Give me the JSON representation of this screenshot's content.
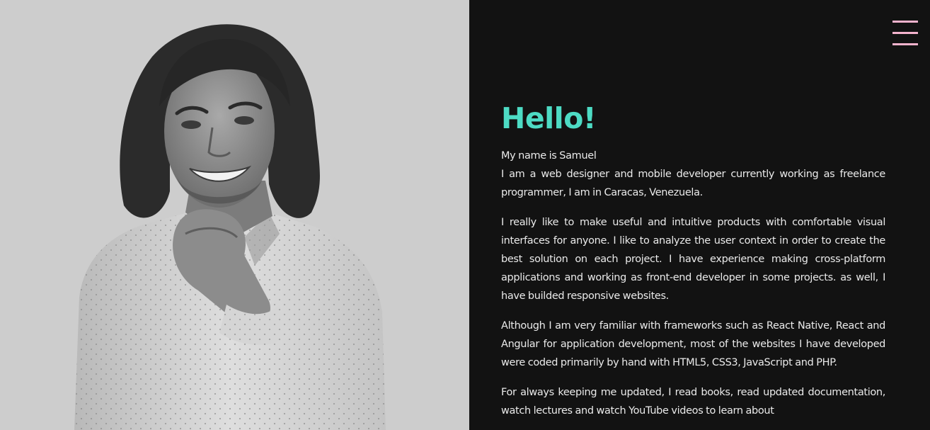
{
  "about": {
    "greeting": "Hello!",
    "name_line": "My name is Samuel",
    "intro_line": "I am a web designer and mobile developer currently working as freelance programmer, I am in Caracas, Venezuela.",
    "paragraphs": [
      "I really like to make useful and intuitive products with comfortable visual interfaces for anyone. I like to analyze the user context in order to create the best solution on each project. I have experience making cross-platform applications and working as front-end developer in some projects. as well, I have builded responsive websites.",
      "Although I am very familiar with frameworks such as React Native, React and Angular for application development, most of the websites I have developed were coded primarily by hand with HTML5, CSS3, JavaScript and PHP.",
      "For always keeping me updated, I read books, read updated documentation, watch lectures and watch YouTube videos to learn about"
    ]
  },
  "menu": {
    "icon": "hamburger-menu-icon"
  },
  "colors": {
    "photo_background": "#cdcdcd",
    "page_background": "#121212",
    "greeting": "#4ddbc4",
    "menu_icon": "#f4b3cd",
    "body_text": "#eaeaea"
  }
}
